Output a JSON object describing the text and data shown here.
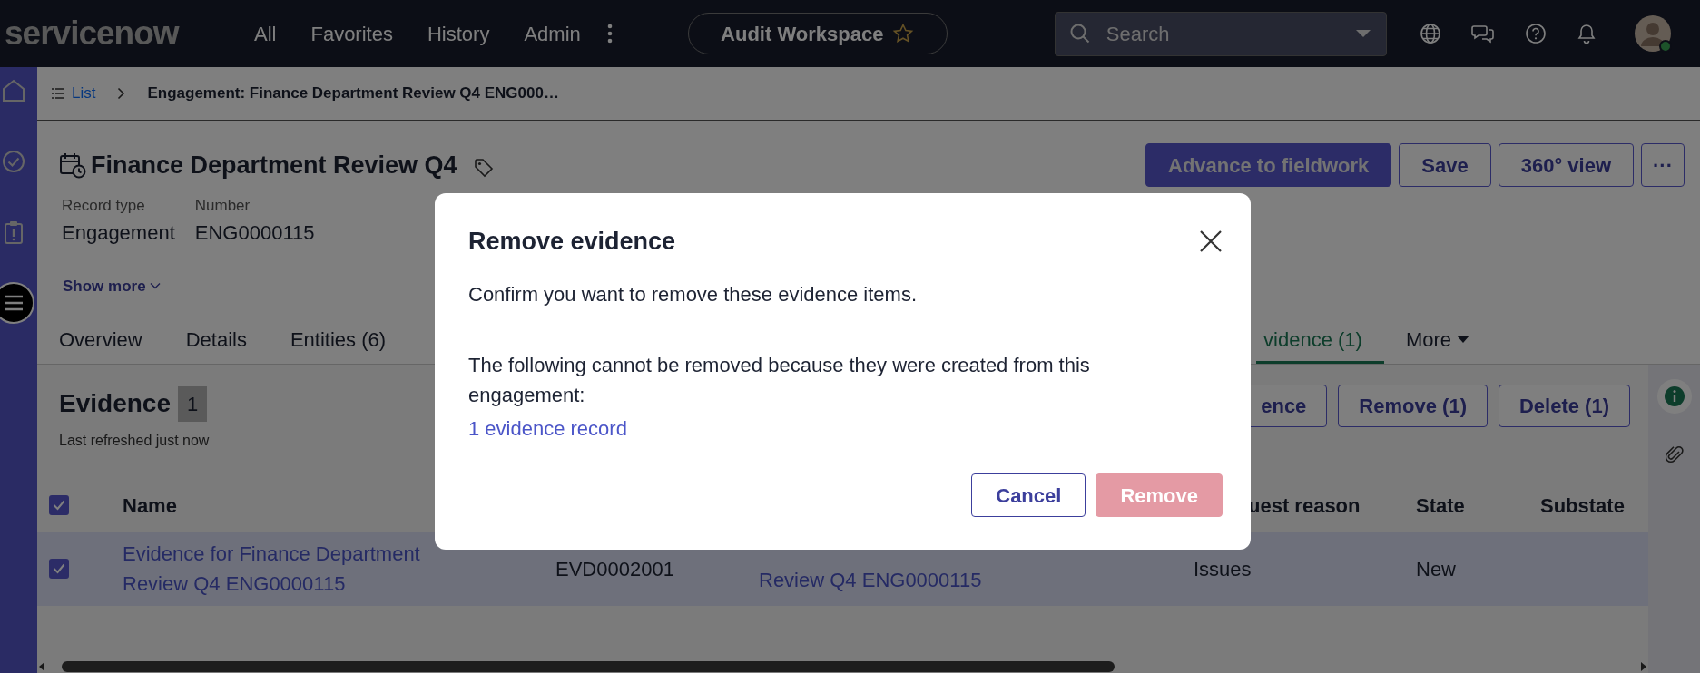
{
  "top_nav": {
    "logo": "servicenow",
    "menu": [
      {
        "label": "All"
      },
      {
        "label": "Favorites"
      },
      {
        "label": "History"
      },
      {
        "label": "Admin"
      }
    ],
    "workspace": {
      "label": "Audit Workspace",
      "starred": false
    },
    "search": {
      "placeholder": "Search"
    },
    "user": {
      "online": true
    }
  },
  "sidebar": {
    "items": [
      {
        "kind": "home",
        "selected": false
      },
      {
        "kind": "check",
        "selected": false
      },
      {
        "kind": "clipboard",
        "selected": false
      },
      {
        "kind": "menu",
        "selected": true
      }
    ]
  },
  "breadcrumb": {
    "list_label": "List",
    "current": "Engagement: Finance Department Review Q4 ENG000…"
  },
  "record": {
    "title": "Finance Department Review Q4",
    "fields": [
      {
        "label": "Record type",
        "value": "Engagement"
      },
      {
        "label": "Number",
        "value": "ENG0000115"
      }
    ],
    "show_more": "Show more"
  },
  "actions": [
    {
      "kind": "primary",
      "label": "Advance to fieldwork"
    },
    {
      "kind": "outline",
      "label": "Save"
    },
    {
      "kind": "outline",
      "label": "360° view"
    },
    {
      "kind": "outline",
      "label": "···"
    }
  ],
  "tabs": [
    {
      "label": "Overview",
      "selected": false
    },
    {
      "label": "Details",
      "selected": false
    },
    {
      "label": "Entities (6)",
      "selected": false
    },
    {
      "label": "vidence (1)",
      "selected": true
    },
    {
      "label": "More",
      "selected": false,
      "dropdown": true
    }
  ],
  "evidence": {
    "title": "Evidence",
    "count": "1",
    "refreshed": "Last refreshed just now",
    "toolbar": [
      {
        "label": "ence"
      },
      {
        "label": "Remove (1)"
      },
      {
        "label": "Delete (1)"
      }
    ]
  },
  "table": {
    "all_checked": true,
    "columns": {
      "name": "Name",
      "column_4": "uest reason",
      "state": "State",
      "substate": "Substate"
    },
    "rows": [
      {
        "selected": true,
        "checked": true,
        "name": "Evidence for Finance Department Review Q4 ENG0000115",
        "column_2": "EVD0002001",
        "column_3": "Review Q4 ENG0000115",
        "column_4": "Issues",
        "state": "New"
      }
    ]
  },
  "dialog": {
    "title": "Remove evidence",
    "message": "Confirm you want to remove these evidence items.",
    "note": "The following cannot be removed because they were created from this engagement:",
    "link": "1 evidence record",
    "buttons": [
      {
        "kind": "secondary",
        "label": "Cancel",
        "disabled": false
      },
      {
        "kind": "primary",
        "label": "Remove",
        "disabled": true
      }
    ]
  }
}
